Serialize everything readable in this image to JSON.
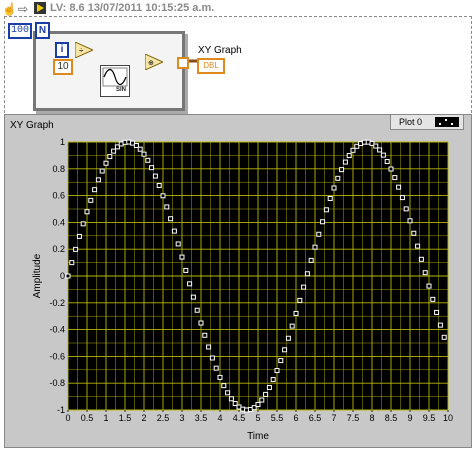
{
  "toolbar": {
    "title": "LV: 8.6 13/07/2011 10:15:25 a.m.",
    "icons": [
      "hand-tool-icon",
      "arrow-icon",
      "run-icon"
    ]
  },
  "diagram": {
    "count_constant": "100",
    "count_terminal": "N",
    "iteration_terminal": "i",
    "divisor_constant": "10",
    "sine_node_label": "SIN",
    "indicator_label": "XY Graph",
    "indicator_terminal": "DBL",
    "colors": {
      "wire_blue": "#1a3ea8",
      "wire_orange": "#e08a1e"
    }
  },
  "graph": {
    "label": "XY Graph",
    "legend_plot_name": "Plot 0",
    "colors": {
      "plot_bg": "#000000",
      "grid": "#b8b800",
      "point": "#ffffff",
      "frame": "#c8c8c8"
    }
  },
  "chart_data": {
    "type": "scatter",
    "title": "",
    "xlabel": "Time",
    "ylabel": "Amplitude",
    "xlim": [
      0,
      10
    ],
    "ylim": [
      -1,
      1
    ],
    "grid": true,
    "legend_position": "top-right",
    "x_ticks": [
      "0",
      "0.5",
      "1",
      "1.5",
      "2",
      "2.5",
      "3",
      "3.5",
      "4",
      "4.5",
      "5",
      "5.5",
      "6",
      "6.5",
      "7",
      "7.5",
      "8",
      "8.5",
      "9",
      "9.5",
      "10"
    ],
    "y_ticks": [
      "-1",
      "-0.8",
      "-0.6",
      "-0.4",
      "-0.2",
      "0",
      "0.2",
      "0.4",
      "0.6",
      "0.8",
      "1"
    ],
    "series": [
      {
        "name": "Plot 0",
        "x": [
          0,
          0.1,
          0.2,
          0.3,
          0.4,
          0.5,
          0.6,
          0.7,
          0.8,
          0.9,
          1,
          1.1,
          1.2,
          1.3,
          1.4,
          1.5,
          1.6,
          1.7,
          1.8,
          1.9,
          2,
          2.1,
          2.2,
          2.3,
          2.4,
          2.5,
          2.6,
          2.7,
          2.8,
          2.9,
          3,
          3.1,
          3.2,
          3.3,
          3.4,
          3.5,
          3.6,
          3.7,
          3.8,
          3.9,
          4,
          4.1,
          4.2,
          4.3,
          4.4,
          4.5,
          4.6,
          4.7,
          4.8,
          4.9,
          5,
          5.1,
          5.2,
          5.3,
          5.4,
          5.5,
          5.6,
          5.7,
          5.8,
          5.9,
          6,
          6.1,
          6.2,
          6.3,
          6.4,
          6.5,
          6.6,
          6.7,
          6.8,
          6.9,
          7,
          7.1,
          7.2,
          7.3,
          7.4,
          7.5,
          7.6,
          7.7,
          7.8,
          7.9,
          8,
          8.1,
          8.2,
          8.3,
          8.4,
          8.5,
          8.6,
          8.7,
          8.8,
          8.9,
          9,
          9.1,
          9.2,
          9.3,
          9.4,
          9.5,
          9.6,
          9.7,
          9.8,
          9.9
        ],
        "y": [
          0,
          0.0998,
          0.1987,
          0.2955,
          0.3894,
          0.4794,
          0.5646,
          0.6442,
          0.7174,
          0.7833,
          0.8415,
          0.8912,
          0.932,
          0.9636,
          0.9854,
          0.9975,
          0.9996,
          0.9917,
          0.9738,
          0.9463,
          0.9093,
          0.8632,
          0.8085,
          0.7457,
          0.6755,
          0.5985,
          0.5155,
          0.4274,
          0.335,
          0.2392,
          0.1411,
          0.0416,
          -0.0584,
          -0.1577,
          -0.2555,
          -0.3508,
          -0.4425,
          -0.5298,
          -0.6119,
          -0.6878,
          -0.7568,
          -0.8183,
          -0.8716,
          -0.9162,
          -0.9516,
          -0.9775,
          -0.9937,
          -0.9999,
          -0.9962,
          -0.9825,
          -0.9589,
          -0.9258,
          -0.8835,
          -0.8323,
          -0.7728,
          -0.7055,
          -0.6313,
          -0.5507,
          -0.4646,
          -0.3739,
          -0.2794,
          -0.1822,
          -0.0831,
          0.0168,
          0.1165,
          0.2151,
          0.3115,
          0.4048,
          0.494,
          0.5784,
          0.657,
          0.729,
          0.7937,
          0.8504,
          0.8987,
          0.938,
          0.9679,
          0.9882,
          0.9985,
          0.9989,
          0.9894,
          0.9699,
          0.9407,
          0.9022,
          0.8546,
          0.7985,
          0.7344,
          0.663,
          0.585,
          0.501,
          0.4121,
          0.319,
          0.2229,
          0.1245,
          0.0248,
          -0.0752,
          -0.1743,
          -0.2718,
          -0.3665,
          -0.4575
        ]
      }
    ]
  }
}
